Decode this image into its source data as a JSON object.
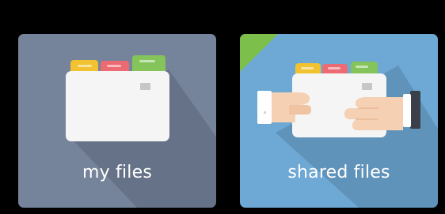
{
  "tiles": [
    {
      "label": "my files",
      "icon": "folder-icon"
    },
    {
      "label": "shared files",
      "icon": "shared-folder-hands-icon"
    }
  ],
  "colors": {
    "page_background": "#000000",
    "my_files_tile": "#76849b",
    "shared_files_tile": "#6ea8d4",
    "shared_corner_accent": "#7cc04b",
    "tab_yellow": "#f2c230",
    "tab_red": "#ec6b73",
    "tab_green": "#84c45a",
    "folder_white": "#f5f5f5",
    "hand_skin": "#f5d0b2"
  }
}
